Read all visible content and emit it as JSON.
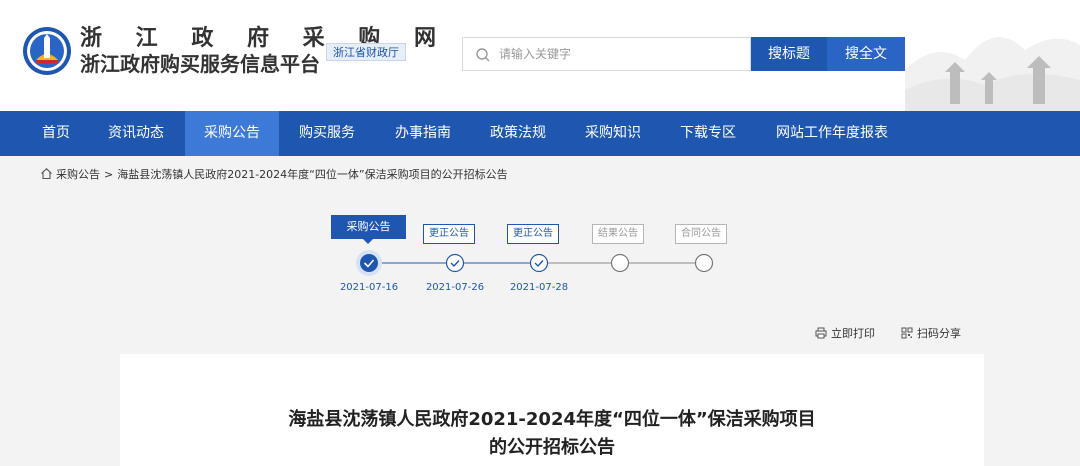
{
  "header": {
    "site_title_line1": "浙 江 政 府 采 购 网",
    "site_title_line2": "浙江政府购买服务信息平台",
    "dept_badge": "浙江省财政厅",
    "search": {
      "placeholder": "请输入关键字",
      "value": ""
    },
    "btn_search_title": "搜标题",
    "btn_search_full": "搜全文"
  },
  "nav": {
    "items": [
      {
        "label": "首页"
      },
      {
        "label": "资讯动态"
      },
      {
        "label": "采购公告"
      },
      {
        "label": "购买服务"
      },
      {
        "label": "办事指南"
      },
      {
        "label": "政策法规"
      },
      {
        "label": "采购知识"
      },
      {
        "label": "下载专区"
      },
      {
        "label": "网站工作年度报表"
      }
    ],
    "active_index": 2
  },
  "breadcrumb": {
    "link": "采购公告",
    "separator": ">",
    "current": "海盐县沈荡镇人民政府2021-2024年度“四位一体”保洁采购项目的公开招标公告"
  },
  "progress": {
    "steps": [
      {
        "label": "采购公告",
        "date": "2021-07-16",
        "status": "current"
      },
      {
        "label": "更正公告",
        "date": "2021-07-26",
        "status": "done"
      },
      {
        "label": "更正公告",
        "date": "2021-07-28",
        "status": "done"
      },
      {
        "label": "结果公告",
        "date": "",
        "status": "pending"
      },
      {
        "label": "合同公告",
        "date": "",
        "status": "pending"
      }
    ]
  },
  "tools": {
    "print": "立即打印",
    "share": "扫码分享"
  },
  "article": {
    "title_line1": "海盐县沈荡镇人民政府2021-2024年度“四位一体”保洁采购项目",
    "title_line2": "的公开招标公告"
  },
  "colors": {
    "primary": "#1f57b0",
    "nav_active": "#3d7ad8",
    "muted": "#b5b5b5",
    "page_bg": "#f3f3f3"
  },
  "icons": [
    "emblem-logo",
    "search-icon",
    "home-icon",
    "check-icon",
    "printer-icon",
    "qrcode-icon",
    "pagoda-scenery"
  ]
}
